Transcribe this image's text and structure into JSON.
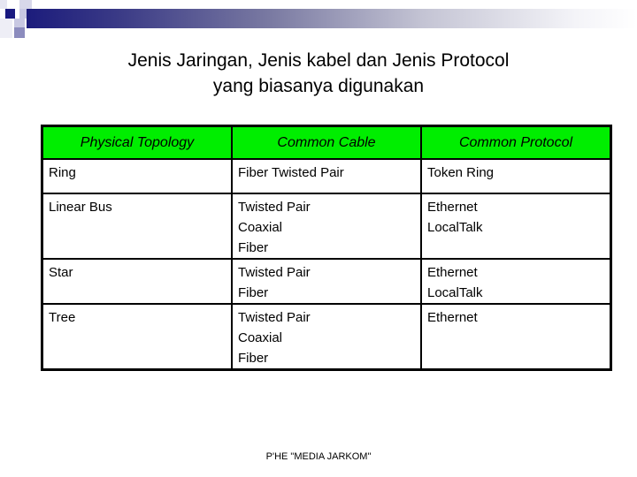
{
  "title": {
    "line1": "Jenis Jaringan, Jenis kabel dan Jenis Protocol",
    "line2": "yang biasanya digunakan"
  },
  "table": {
    "header_color": "#00ee00",
    "headers": [
      "Physical Topology",
      "Common Cable",
      "Common Protocol"
    ],
    "rows": [
      {
        "topology": "Ring",
        "cables": [
          "Fiber Twisted Pair"
        ],
        "protocols": [
          "Token Ring"
        ]
      },
      {
        "topology": "Linear Bus",
        "cables": [
          "Twisted Pair",
          "Coaxial",
          "Fiber"
        ],
        "protocols": [
          "Ethernet",
          "LocalTalk"
        ]
      },
      {
        "topology": "Star",
        "cables": [
          "Twisted Pair",
          "Fiber"
        ],
        "protocols": [
          "Ethernet",
          "LocalTalk"
        ]
      },
      {
        "topology": "Tree",
        "cables": [
          "Twisted Pair",
          "Coaxial",
          "Fiber"
        ],
        "protocols": [
          "Ethernet"
        ]
      }
    ]
  },
  "footer": "P'HE \"MEDIA JARKOM\""
}
